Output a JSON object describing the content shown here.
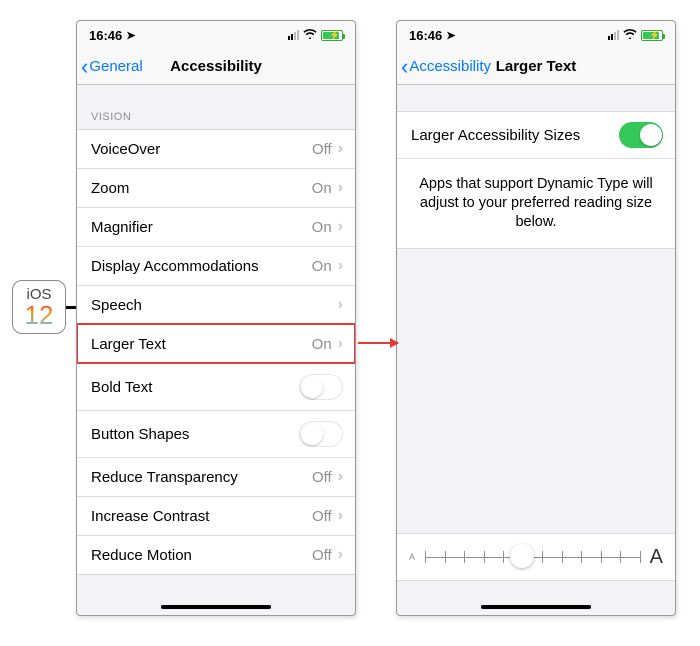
{
  "badge": {
    "line1": "iOS",
    "line2": "12"
  },
  "status": {
    "time": "16:46",
    "locationGlyph": "➤"
  },
  "left": {
    "back": "General",
    "title": "Accessibility",
    "sectionHeader": "VISION",
    "rows": [
      {
        "label": "VoiceOver",
        "value": "Off",
        "type": "disclosure"
      },
      {
        "label": "Zoom",
        "value": "On",
        "type": "disclosure"
      },
      {
        "label": "Magnifier",
        "value": "On",
        "type": "disclosure"
      },
      {
        "label": "Display Accommodations",
        "value": "On",
        "type": "disclosure"
      },
      {
        "label": "Speech",
        "value": "",
        "type": "disclosure"
      },
      {
        "label": "Larger Text",
        "value": "On",
        "type": "disclosure",
        "highlighted": true
      },
      {
        "label": "Bold Text",
        "value": "",
        "type": "toggle",
        "on": false
      },
      {
        "label": "Button Shapes",
        "value": "",
        "type": "toggle",
        "on": false
      },
      {
        "label": "Reduce Transparency",
        "value": "Off",
        "type": "disclosure"
      },
      {
        "label": "Increase Contrast",
        "value": "Off",
        "type": "disclosure"
      },
      {
        "label": "Reduce Motion",
        "value": "Off",
        "type": "disclosure"
      }
    ]
  },
  "right": {
    "back": "Accessibility",
    "title": "Larger Text",
    "toggleLabel": "Larger Accessibility Sizes",
    "toggleOn": true,
    "description": "Apps that support Dynamic Type will adjust to your preferred reading size below.",
    "sliderMinGlyph": "A",
    "sliderMaxGlyph": "A",
    "sliderTicks": 12,
    "sliderPositionPercent": 45
  }
}
